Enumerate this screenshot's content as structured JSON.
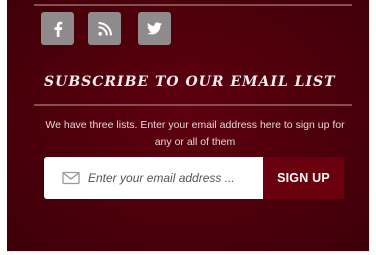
{
  "social": {
    "icons": [
      "facebook-icon",
      "rss-icon",
      "twitter-icon"
    ],
    "icon_bg": "#8f8a8b",
    "icon_fg": "#ffffff"
  },
  "subscribe": {
    "heading": "SUBSCRIBE TO OUR EMAIL LIST",
    "description": "We have three lists. Enter your email address here to sign up for any or all of them",
    "email_placeholder": "Enter your email address ...",
    "email_value": "",
    "button_label": "SIGN UP"
  },
  "colors": {
    "panel_bg": "#4f000b",
    "button_bg": "#6a000e",
    "rule": "#8a4d55",
    "heading_text": "#f4eeee"
  }
}
